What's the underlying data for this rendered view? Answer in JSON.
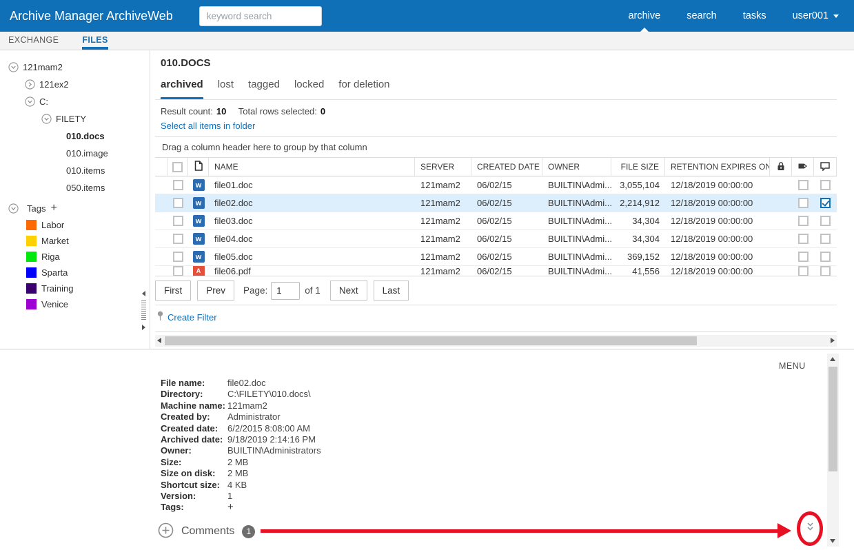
{
  "app": {
    "title": "Archive Manager ArchiveWeb",
    "search_placeholder": "keyword search",
    "nav": [
      {
        "label": "archive",
        "active": true,
        "dropdown": false
      },
      {
        "label": "search",
        "active": false,
        "dropdown": false
      },
      {
        "label": "tasks",
        "active": false,
        "dropdown": false
      },
      {
        "label": "user001",
        "active": false,
        "dropdown": true
      }
    ]
  },
  "module_tabs": [
    {
      "label": "EXCHANGE",
      "active": false
    },
    {
      "label": "FILES",
      "active": true
    }
  ],
  "sidebar": {
    "tree": [
      {
        "label": "121mam2",
        "level": 0,
        "icon": "expanded",
        "selected": false
      },
      {
        "label": "121ex2",
        "level": 1,
        "icon": "collapsed",
        "selected": false
      },
      {
        "label": "C:",
        "level": 1,
        "icon": "expanded",
        "selected": false
      },
      {
        "label": "FILETY",
        "level": 2,
        "icon": "expanded",
        "selected": false
      },
      {
        "label": "010.docs",
        "level": 3,
        "icon": "none",
        "selected": true
      },
      {
        "label": "010.image",
        "level": 3,
        "icon": "none",
        "selected": false
      },
      {
        "label": "010.items",
        "level": 3,
        "icon": "none",
        "selected": false
      },
      {
        "label": "050.items",
        "level": 3,
        "icon": "none",
        "selected": false
      }
    ],
    "tags_label": "Tags",
    "tags_add": "+",
    "tags": [
      {
        "label": "Labor",
        "color": "#ff6a00"
      },
      {
        "label": "Market",
        "color": "#ffd100"
      },
      {
        "label": "Riga",
        "color": "#00e80e"
      },
      {
        "label": "Sparta",
        "color": "#0000ff"
      },
      {
        "label": "Training",
        "color": "#3a006e"
      },
      {
        "label": "Venice",
        "color": "#9e00d4"
      }
    ]
  },
  "main": {
    "folder_title": "010.DOCS",
    "view_tabs": [
      {
        "label": "archived",
        "active": true
      },
      {
        "label": "lost",
        "active": false
      },
      {
        "label": "tagged",
        "active": false
      },
      {
        "label": "locked",
        "active": false
      },
      {
        "label": "for deletion",
        "active": false
      }
    ],
    "result_count_label": "Result count:",
    "result_count": "10",
    "rows_selected_label": "Total rows selected:",
    "rows_selected": "0",
    "select_all_link": "Select all items in folder",
    "group_hint": "Drag a column header here to group by that column",
    "table": {
      "columns": [
        "NAME",
        "SERVER",
        "CREATED DATE",
        "OWNER",
        "FILE SIZE",
        "RETENTION EXPIRES ON"
      ],
      "rows": [
        {
          "name": "file01.doc",
          "type": "word",
          "server": "121mam2",
          "created": "06/02/15",
          "owner": "BUILTIN\\Admi...",
          "size": "3,055,104",
          "retention": "12/18/2019 00:00:00",
          "tagged": false,
          "commented": false,
          "selected": false,
          "partial": false
        },
        {
          "name": "file02.doc",
          "type": "word",
          "server": "121mam2",
          "created": "06/02/15",
          "owner": "BUILTIN\\Admi...",
          "size": "2,214,912",
          "retention": "12/18/2019 00:00:00",
          "tagged": false,
          "commented": true,
          "selected": true,
          "partial": false
        },
        {
          "name": "file03.doc",
          "type": "word",
          "server": "121mam2",
          "created": "06/02/15",
          "owner": "BUILTIN\\Admi...",
          "size": "34,304",
          "retention": "12/18/2019 00:00:00",
          "tagged": false,
          "commented": false,
          "selected": false,
          "partial": false
        },
        {
          "name": "file04.doc",
          "type": "word",
          "server": "121mam2",
          "created": "06/02/15",
          "owner": "BUILTIN\\Admi...",
          "size": "34,304",
          "retention": "12/18/2019 00:00:00",
          "tagged": false,
          "commented": false,
          "selected": false,
          "partial": false
        },
        {
          "name": "file05.doc",
          "type": "word",
          "server": "121mam2",
          "created": "06/02/15",
          "owner": "BUILTIN\\Admi...",
          "size": "369,152",
          "retention": "12/18/2019 00:00:00",
          "tagged": false,
          "commented": false,
          "selected": false,
          "partial": false
        },
        {
          "name": "file06.pdf",
          "type": "pdf",
          "server": "121mam2",
          "created": "06/02/15",
          "owner": "BUILTIN\\Admi...",
          "size": "41,556",
          "retention": "12/18/2019 00:00:00",
          "tagged": false,
          "commented": false,
          "selected": false,
          "partial": true
        }
      ]
    },
    "pagination": {
      "first": "First",
      "prev": "Prev",
      "page_label": "Page:",
      "page_value": "1",
      "of": "of 1",
      "next": "Next",
      "last": "Last"
    },
    "create_filter": "Create Filter"
  },
  "details": {
    "menu_label": "MENU",
    "fields": [
      {
        "label": "File name:",
        "value": "file02.doc",
        "clickable": false
      },
      {
        "label": "Directory:",
        "value": "C:\\FILETY\\010.docs\\",
        "clickable": false
      },
      {
        "label": "Machine name:",
        "value": "121mam2",
        "clickable": false
      },
      {
        "label": "Created by:",
        "value": "Administrator",
        "clickable": false
      },
      {
        "label": "Created date:",
        "value": "6/2/2015 8:08:00 AM",
        "clickable": false
      },
      {
        "label": "Archived date:",
        "value": "9/18/2019 2:14:16 PM",
        "clickable": false
      },
      {
        "label": "Owner:",
        "value": "BUILTIN\\Administrators",
        "clickable": false
      },
      {
        "label": "Size:",
        "value": "2 MB",
        "clickable": false
      },
      {
        "label": "Size on disk:",
        "value": "2 MB",
        "clickable": false
      },
      {
        "label": "Shortcut size:",
        "value": "4 KB",
        "clickable": false
      },
      {
        "label": "Version:",
        "value": "1",
        "clickable": false
      },
      {
        "label": "Tags:",
        "value": "+",
        "clickable": true
      }
    ],
    "comments_label": "Comments",
    "comments_count": "1"
  },
  "colors": {
    "accent": "#0f70b8",
    "annotation": "#e81123"
  }
}
